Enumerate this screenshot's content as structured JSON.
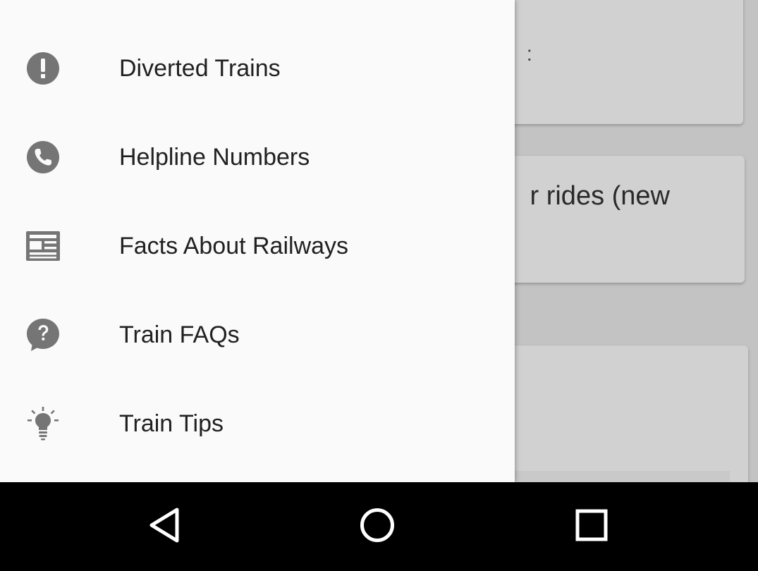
{
  "background": {
    "card_1_text": ":",
    "card_2_text": "r rides (new"
  },
  "drawer": {
    "items": [
      {
        "label": "Diverted Trains",
        "icon": "exclamation-circle-icon"
      },
      {
        "label": "Helpline Numbers",
        "icon": "phone-icon"
      },
      {
        "label": "Facts About Railways",
        "icon": "newspaper-icon"
      },
      {
        "label": "Train FAQs",
        "icon": "question-bubble-icon"
      },
      {
        "label": "Train Tips",
        "icon": "lightbulb-icon"
      }
    ]
  },
  "nav_bar": {
    "buttons": [
      "back-icon",
      "home-icon",
      "recents-icon"
    ]
  },
  "colors": {
    "drawer_background": "#fafafa",
    "icon_gray": "#757575",
    "label_text": "#212121",
    "nav_bar": "#000000"
  }
}
